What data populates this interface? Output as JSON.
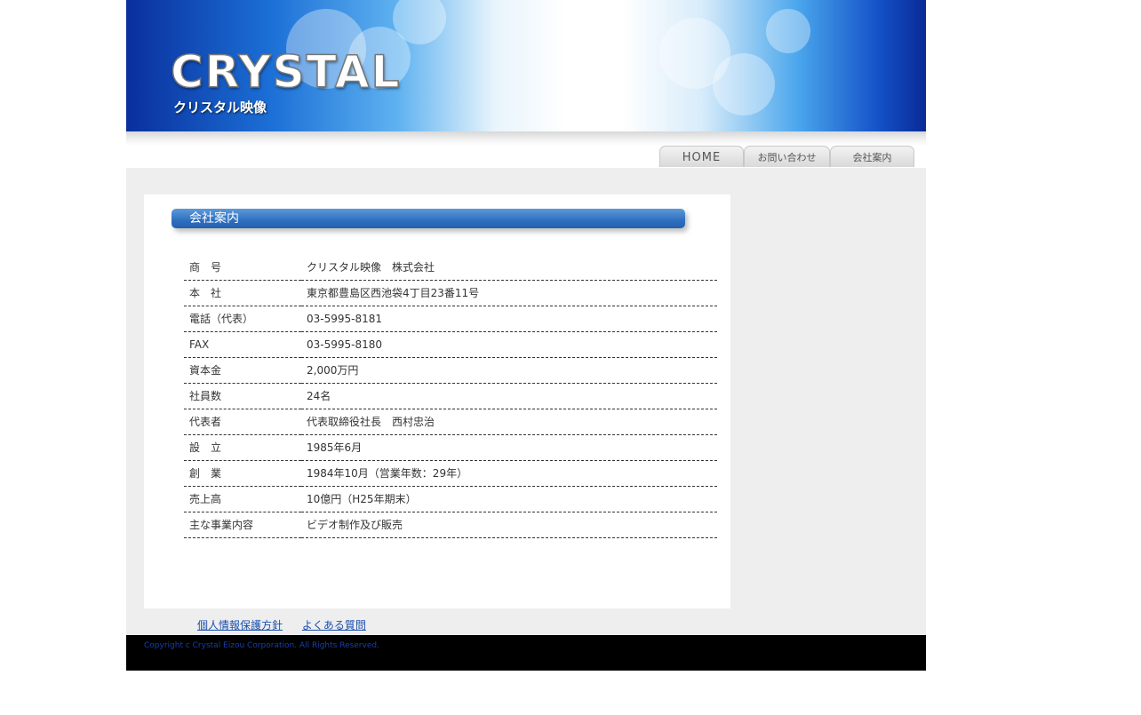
{
  "header": {
    "logo_text": "CRYSTAL",
    "logo_subtitle": "クリスタル映像"
  },
  "nav": {
    "items": [
      {
        "label": "HOME"
      },
      {
        "label": "お問い合わせ"
      },
      {
        "label": "会社案内"
      }
    ]
  },
  "main": {
    "section_title": "会社案内",
    "rows": [
      {
        "label": "商　号",
        "value": "クリスタル映像　株式会社"
      },
      {
        "label": "本　社",
        "value": "東京都豊島区西池袋4丁目23番11号"
      },
      {
        "label": "電話（代表）",
        "value": "03-5995-8181"
      },
      {
        "label": "FAX",
        "value": "03-5995-8180"
      },
      {
        "label": "資本金",
        "value": "2,000万円"
      },
      {
        "label": "社員数",
        "value": "24名"
      },
      {
        "label": "代表者",
        "value": "代表取締役社長　西村忠治"
      },
      {
        "label": "設　立",
        "value": "1985年6月"
      },
      {
        "label": "創　業",
        "value": "1984年10月（営業年数：29年）"
      },
      {
        "label": "売上高",
        "value": "10億円（H25年期末）"
      },
      {
        "label": "主な事業内容",
        "value": "ビデオ制作及び販売"
      }
    ]
  },
  "footer": {
    "links": [
      {
        "label": "個人情報保護方針"
      },
      {
        "label": "よくある質問"
      }
    ],
    "copyright": "Copyright c Crystal Eizou Corporation. All Rights Reserved."
  }
}
